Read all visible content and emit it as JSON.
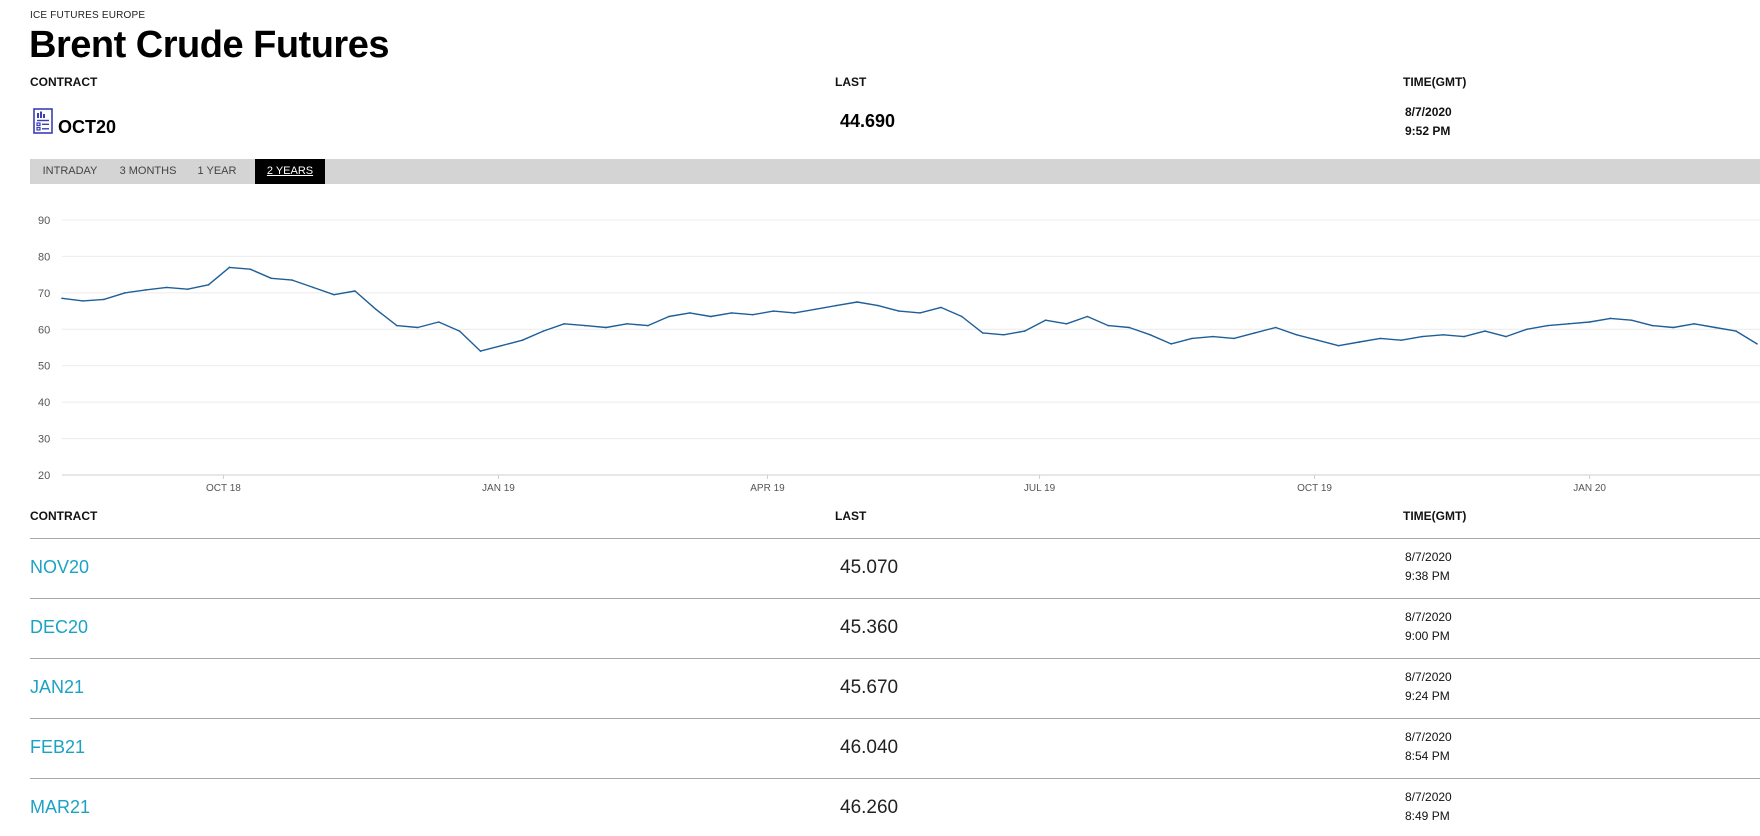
{
  "header": {
    "exchange": "ICE FUTURES EUROPE",
    "title": "Brent Crude Futures"
  },
  "columns": {
    "contract": "CONTRACT",
    "last": "LAST",
    "time": "TIME(GMT)"
  },
  "front_contract": {
    "icon": "document-chart-icon",
    "code": "OCT20",
    "last": "44.690",
    "date": "8/7/2020",
    "time": "9:52 PM"
  },
  "tabs": [
    {
      "label": "INTRADAY",
      "active": false
    },
    {
      "label": "3 MONTHS",
      "active": false
    },
    {
      "label": "1 YEAR",
      "active": false
    },
    {
      "label": "2 YEARS",
      "active": true
    }
  ],
  "colors": {
    "line": "#1f5f99",
    "link": "#1aa3c4",
    "tab_bg": "#d4d4d4",
    "grid": "#ececec"
  },
  "chart_data": {
    "type": "line",
    "title": "",
    "xlabel": "",
    "ylabel": "",
    "ylim": [
      20,
      90
    ],
    "yticks": [
      90,
      80,
      70,
      60,
      50,
      40,
      30,
      20
    ],
    "xlim": [
      "2018-08-08",
      "2020-02-27"
    ],
    "xticks": [
      {
        "label": "OCT 18",
        "date": "2018-10-01"
      },
      {
        "label": "JAN 19",
        "date": "2019-01-01"
      },
      {
        "label": "APR 19",
        "date": "2019-04-01"
      },
      {
        "label": "JUL 19",
        "date": "2019-07-01"
      },
      {
        "label": "OCT 19",
        "date": "2019-10-01"
      },
      {
        "label": "JAN 20",
        "date": "2020-01-01"
      }
    ],
    "grid": true,
    "series": [
      {
        "values": [
          {
            "x": "2018-08-08",
            "y": 68.5
          },
          {
            "x": "2018-08-15",
            "y": 67.8
          },
          {
            "x": "2018-08-22",
            "y": 68.2
          },
          {
            "x": "2018-08-29",
            "y": 70.0
          },
          {
            "x": "2018-09-05",
            "y": 70.8
          },
          {
            "x": "2018-09-12",
            "y": 71.5
          },
          {
            "x": "2018-09-19",
            "y": 71.0
          },
          {
            "x": "2018-09-26",
            "y": 72.2
          },
          {
            "x": "2018-10-03",
            "y": 77.0
          },
          {
            "x": "2018-10-10",
            "y": 76.5
          },
          {
            "x": "2018-10-17",
            "y": 74.0
          },
          {
            "x": "2018-10-24",
            "y": 73.5
          },
          {
            "x": "2018-10-31",
            "y": 71.5
          },
          {
            "x": "2018-11-07",
            "y": 69.5
          },
          {
            "x": "2018-11-14",
            "y": 70.5
          },
          {
            "x": "2018-11-21",
            "y": 65.5
          },
          {
            "x": "2018-11-28",
            "y": 61.0
          },
          {
            "x": "2018-12-05",
            "y": 60.5
          },
          {
            "x": "2018-12-12",
            "y": 62.0
          },
          {
            "x": "2018-12-19",
            "y": 59.5
          },
          {
            "x": "2018-12-26",
            "y": 54.0
          },
          {
            "x": "2019-01-02",
            "y": 55.5
          },
          {
            "x": "2019-01-09",
            "y": 57.0
          },
          {
            "x": "2019-01-16",
            "y": 59.5
          },
          {
            "x": "2019-01-23",
            "y": 61.5
          },
          {
            "x": "2019-01-30",
            "y": 61.0
          },
          {
            "x": "2019-02-06",
            "y": 60.5
          },
          {
            "x": "2019-02-13",
            "y": 61.5
          },
          {
            "x": "2019-02-20",
            "y": 61.0
          },
          {
            "x": "2019-02-27",
            "y": 63.5
          },
          {
            "x": "2019-03-06",
            "y": 64.5
          },
          {
            "x": "2019-03-13",
            "y": 63.5
          },
          {
            "x": "2019-03-20",
            "y": 64.5
          },
          {
            "x": "2019-03-27",
            "y": 64.0
          },
          {
            "x": "2019-04-03",
            "y": 65.0
          },
          {
            "x": "2019-04-10",
            "y": 64.5
          },
          {
            "x": "2019-04-17",
            "y": 65.5
          },
          {
            "x": "2019-04-24",
            "y": 66.5
          },
          {
            "x": "2019-05-01",
            "y": 67.5
          },
          {
            "x": "2019-05-08",
            "y": 66.5
          },
          {
            "x": "2019-05-15",
            "y": 65.0
          },
          {
            "x": "2019-05-22",
            "y": 64.5
          },
          {
            "x": "2019-05-29",
            "y": 66.0
          },
          {
            "x": "2019-06-05",
            "y": 63.5
          },
          {
            "x": "2019-06-12",
            "y": 59.0
          },
          {
            "x": "2019-06-19",
            "y": 58.5
          },
          {
            "x": "2019-06-26",
            "y": 59.5
          },
          {
            "x": "2019-07-03",
            "y": 62.5
          },
          {
            "x": "2019-07-10",
            "y": 61.5
          },
          {
            "x": "2019-07-17",
            "y": 63.5
          },
          {
            "x": "2019-07-24",
            "y": 61.0
          },
          {
            "x": "2019-07-31",
            "y": 60.5
          },
          {
            "x": "2019-08-07",
            "y": 58.5
          },
          {
            "x": "2019-08-14",
            "y": 56.0
          },
          {
            "x": "2019-08-21",
            "y": 57.5
          },
          {
            "x": "2019-08-28",
            "y": 58.0
          },
          {
            "x": "2019-09-04",
            "y": 57.5
          },
          {
            "x": "2019-09-11",
            "y": 59.0
          },
          {
            "x": "2019-09-18",
            "y": 60.5
          },
          {
            "x": "2019-09-25",
            "y": 58.5
          },
          {
            "x": "2019-10-02",
            "y": 57.0
          },
          {
            "x": "2019-10-09",
            "y": 55.5
          },
          {
            "x": "2019-10-16",
            "y": 56.5
          },
          {
            "x": "2019-10-23",
            "y": 57.5
          },
          {
            "x": "2019-10-30",
            "y": 57.0
          },
          {
            "x": "2019-11-06",
            "y": 58.0
          },
          {
            "x": "2019-11-13",
            "y": 58.5
          },
          {
            "x": "2019-11-20",
            "y": 58.0
          },
          {
            "x": "2019-11-27",
            "y": 59.5
          },
          {
            "x": "2019-12-04",
            "y": 58.0
          },
          {
            "x": "2019-12-11",
            "y": 60.0
          },
          {
            "x": "2019-12-18",
            "y": 61.0
          },
          {
            "x": "2019-12-25",
            "y": 61.5
          },
          {
            "x": "2020-01-01",
            "y": 62.0
          },
          {
            "x": "2020-01-08",
            "y": 63.0
          },
          {
            "x": "2020-01-15",
            "y": 62.5
          },
          {
            "x": "2020-01-22",
            "y": 61.0
          },
          {
            "x": "2020-01-29",
            "y": 60.5
          },
          {
            "x": "2020-02-05",
            "y": 61.5
          },
          {
            "x": "2020-02-12",
            "y": 60.5
          },
          {
            "x": "2020-02-19",
            "y": 59.5
          },
          {
            "x": "2020-02-26",
            "y": 56.0
          }
        ]
      }
    ]
  },
  "rows": [
    {
      "code": "NOV20",
      "last": "45.070",
      "date": "8/7/2020",
      "time": "9:38 PM"
    },
    {
      "code": "DEC20",
      "last": "45.360",
      "date": "8/7/2020",
      "time": "9:00 PM"
    },
    {
      "code": "JAN21",
      "last": "45.670",
      "date": "8/7/2020",
      "time": "9:24 PM"
    },
    {
      "code": "FEB21",
      "last": "46.040",
      "date": "8/7/2020",
      "time": "8:54 PM"
    },
    {
      "code": "MAR21",
      "last": "46.260",
      "date": "8/7/2020",
      "time": "8:49 PM"
    }
  ]
}
